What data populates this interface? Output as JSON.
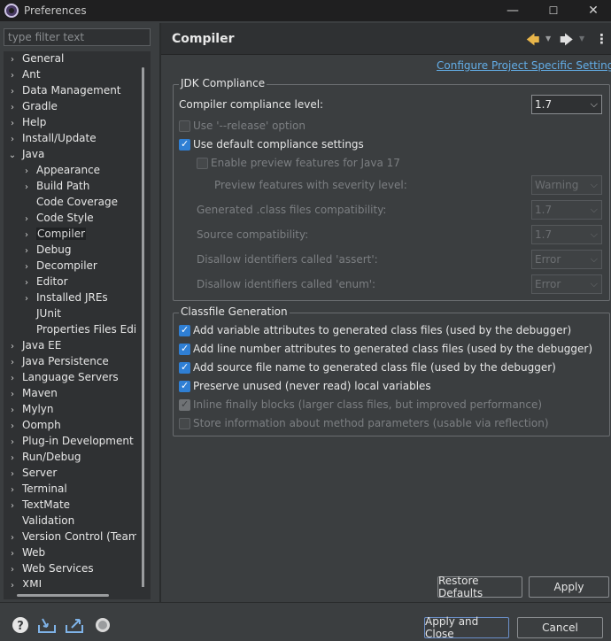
{
  "window": {
    "title": "Preferences",
    "minimize": "—",
    "maximize": "☐",
    "close": "✕"
  },
  "filter": {
    "placeholder": "type filter text"
  },
  "tree": {
    "items": [
      {
        "label": "General",
        "level": 0,
        "expander": "›"
      },
      {
        "label": "Ant",
        "level": 0,
        "expander": "›"
      },
      {
        "label": "Data Management",
        "level": 0,
        "expander": "›"
      },
      {
        "label": "Gradle",
        "level": 0,
        "expander": "›"
      },
      {
        "label": "Help",
        "level": 0,
        "expander": "›"
      },
      {
        "label": "Install/Update",
        "level": 0,
        "expander": "›"
      },
      {
        "label": "Java",
        "level": 0,
        "expander": "⌄"
      },
      {
        "label": "Appearance",
        "level": 1,
        "expander": "›"
      },
      {
        "label": "Build Path",
        "level": 1,
        "expander": "›"
      },
      {
        "label": "Code Coverage",
        "level": 1,
        "expander": ""
      },
      {
        "label": "Code Style",
        "level": 1,
        "expander": "›"
      },
      {
        "label": "Compiler",
        "level": 1,
        "expander": "›",
        "selected": true
      },
      {
        "label": "Debug",
        "level": 1,
        "expander": "›"
      },
      {
        "label": "Decompiler",
        "level": 1,
        "expander": "›"
      },
      {
        "label": "Editor",
        "level": 1,
        "expander": "›"
      },
      {
        "label": "Installed JREs",
        "level": 1,
        "expander": "›"
      },
      {
        "label": "JUnit",
        "level": 1,
        "expander": ""
      },
      {
        "label": "Properties Files Editor",
        "level": 1,
        "expander": ""
      },
      {
        "label": "Java EE",
        "level": 0,
        "expander": "›"
      },
      {
        "label": "Java Persistence",
        "level": 0,
        "expander": "›"
      },
      {
        "label": "Language Servers",
        "level": 0,
        "expander": "›"
      },
      {
        "label": "Maven",
        "level": 0,
        "expander": "›"
      },
      {
        "label": "Mylyn",
        "level": 0,
        "expander": "›"
      },
      {
        "label": "Oomph",
        "level": 0,
        "expander": "›"
      },
      {
        "label": "Plug-in Development",
        "level": 0,
        "expander": "›"
      },
      {
        "label": "Run/Debug",
        "level": 0,
        "expander": "›"
      },
      {
        "label": "Server",
        "level": 0,
        "expander": "›"
      },
      {
        "label": "Terminal",
        "level": 0,
        "expander": "›"
      },
      {
        "label": "TextMate",
        "level": 0,
        "expander": "›"
      },
      {
        "label": "Validation",
        "level": 0,
        "expander": ""
      },
      {
        "label": "Version Control (Team)",
        "level": 0,
        "expander": "›"
      },
      {
        "label": "Web",
        "level": 0,
        "expander": "›"
      },
      {
        "label": "Web Services",
        "level": 0,
        "expander": "›"
      },
      {
        "label": "XML",
        "level": 0,
        "expander": "›"
      }
    ]
  },
  "page": {
    "title": "Compiler",
    "back_icon": "🡄",
    "forward_icon": "🡆",
    "menu_icon": "⋮",
    "configure_link": "Configure Project Specific Settings..."
  },
  "jdk": {
    "group_title": "JDK Compliance",
    "compliance_label": "Compiler compliance level:",
    "compliance_value": "1.7",
    "release_label": "Use '--release' option",
    "use_default_label": "Use default compliance settings",
    "preview_label": "Enable preview features for Java 17",
    "preview_severity_label": "Preview features with severity level:",
    "preview_severity_value": "Warning",
    "generated_label": "Generated .class files compatibility:",
    "generated_value": "1.7",
    "source_label": "Source compatibility:",
    "source_value": "1.7",
    "assert_label": "Disallow identifiers called 'assert':",
    "assert_value": "Error",
    "enum_label": "Disallow identifiers called 'enum':",
    "enum_value": "Error"
  },
  "classfile": {
    "group_title": "Classfile Generation",
    "opt1": "Add variable attributes to generated class files (used by the debugger)",
    "opt2": "Add line number attributes to generated class files (used by the debugger)",
    "opt3": "Add source file name to generated class file (used by the debugger)",
    "opt4": "Preserve unused (never read) local variables",
    "opt5": "Inline finally blocks (larger class files, but improved performance)",
    "opt6": "Store information about method parameters (usable via reflection)"
  },
  "buttons": {
    "restore_defaults": "Restore Defaults",
    "apply": "Apply",
    "apply_and_close": "Apply and Close",
    "cancel": "Cancel"
  },
  "footer_icons": [
    "help-icon",
    "import-icon",
    "export-icon",
    "record-icon"
  ],
  "colors": {
    "accent": "#2f7fd4",
    "link": "#63aee8",
    "background": "#3b3e40"
  }
}
